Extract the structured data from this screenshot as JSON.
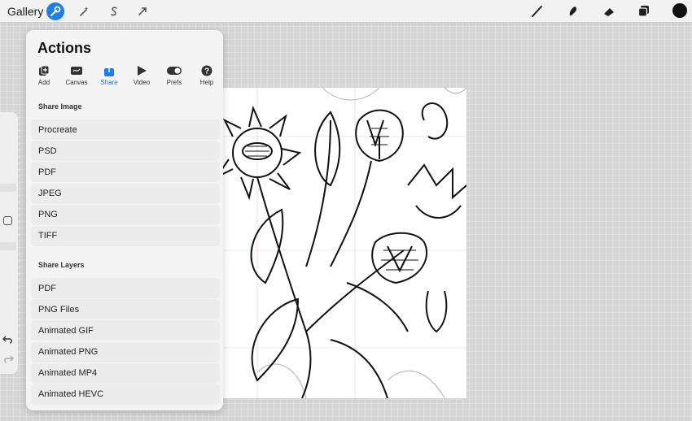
{
  "topbar": {
    "gallery_label": "Gallery",
    "tools": [
      {
        "name": "wrench-icon",
        "active": true
      },
      {
        "name": "magic-wand-icon",
        "active": false
      },
      {
        "name": "selection-s-icon",
        "active": false
      },
      {
        "name": "transform-arrow-icon",
        "active": false
      }
    ],
    "right_tools": [
      "brush-icon",
      "smudge-icon",
      "eraser-icon",
      "layers-icon"
    ],
    "current_color": "#111111"
  },
  "panel": {
    "title": "Actions",
    "tabs": [
      {
        "label": "Add",
        "icon": "add-icon"
      },
      {
        "label": "Canvas",
        "icon": "canvas-icon"
      },
      {
        "label": "Share",
        "icon": "share-icon",
        "active": true
      },
      {
        "label": "Video",
        "icon": "video-play-icon"
      },
      {
        "label": "Prefs",
        "icon": "toggle-icon"
      },
      {
        "label": "Help",
        "icon": "help-icon"
      }
    ],
    "share_image_label": "Share Image",
    "share_image_items": [
      "Procreate",
      "PSD",
      "PDF",
      "JPEG",
      "PNG",
      "TIFF"
    ],
    "share_layers_label": "Share Layers",
    "share_layers_items": [
      "PDF",
      "PNG Files",
      "Animated GIF",
      "Animated PNG",
      "Animated MP4",
      "Animated HEVC"
    ]
  },
  "colors": {
    "accent": "#1a7ff0",
    "panel_bg": "#f4f4f4",
    "item_bg": "#ececec"
  }
}
